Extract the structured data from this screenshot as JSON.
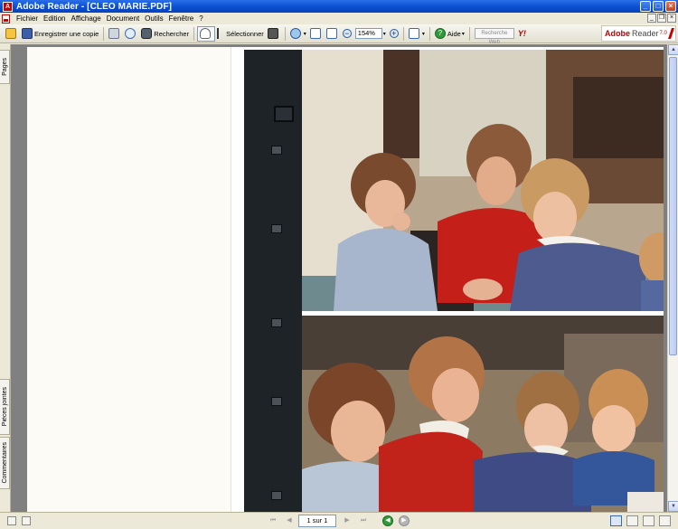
{
  "window": {
    "title": "Adobe Reader - [CLEO MARIE.PDF]",
    "icon_label": "A",
    "buttons": {
      "minimize": "_",
      "maximize": "□",
      "close": "×"
    }
  },
  "menu": {
    "items": [
      "Fichier",
      "Edition",
      "Affichage",
      "Document",
      "Outils",
      "Fenêtre",
      "?"
    ],
    "mdi_buttons": {
      "minimize": "_",
      "restore": "❐",
      "close": "×"
    }
  },
  "toolbar": {
    "save_copy_label": "Enregistrer une copie",
    "search_label": "Rechercher",
    "select_label": "Sélectionner",
    "zoom_value": "154%",
    "help_label": "Aide",
    "web_search_placeholder": "Recherche Web",
    "yahoo_label": "Y!",
    "dropdown_arrow": "▾",
    "minus": "−",
    "plus": "+"
  },
  "brand": {
    "adobe": "Adobe",
    "reader": "Reader",
    "version": "7.0"
  },
  "nav_tabs": {
    "pages": "Pages",
    "attachments": "Pièces jointes",
    "comments": "Commentaires"
  },
  "status": {
    "page_indicator": "1 sur 1",
    "first": "⏮",
    "prev": "◀",
    "next": "▶",
    "last": "⏭",
    "back": "◀",
    "forward": "▶"
  },
  "scrollbar": {
    "up": "▲",
    "down": "▼"
  },
  "colors": {
    "titlebar": "#0a4fd0",
    "chrome": "#ece9d8",
    "doc_background": "#808080",
    "film": "#1d2327",
    "brand_red": "#c60000"
  }
}
